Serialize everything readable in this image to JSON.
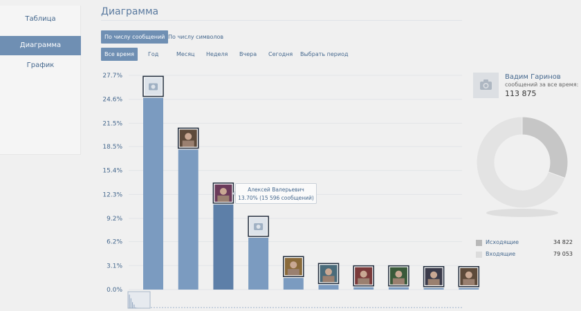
{
  "nav": {
    "items": [
      {
        "label": "Таблица"
      },
      {
        "label": "Диаграмма"
      },
      {
        "label": "График"
      }
    ]
  },
  "page_title": "Диаграмма",
  "metric_tabs": [
    {
      "label": "По числу сообщений"
    },
    {
      "label": "По числу символов"
    }
  ],
  "period_tabs": [
    {
      "label": "Все время"
    },
    {
      "label": "Год"
    },
    {
      "label": "Месяц"
    },
    {
      "label": "Неделя"
    },
    {
      "label": "Вчера"
    },
    {
      "label": "Сегодня"
    },
    {
      "label": "Выбрать период"
    }
  ],
  "tooltip": {
    "name": "Алексей Валерьевич",
    "value": "13.70% (15 596 сообщений)"
  },
  "user": {
    "name": "Вадим Гаринов",
    "subtitle": "сообщений за все время:",
    "count": "113 875"
  },
  "legend": [
    {
      "label": "Исходящие",
      "value": "34 822",
      "color": "#b8b8b8"
    },
    {
      "label": "Входящие",
      "value": "79 053",
      "color": "#dcdcdc"
    }
  ],
  "colors": {
    "accent": "#6f8fb3",
    "bar": "#7b9bc0",
    "bar_highlight": "#5d7fa8",
    "donut_out": "#c6c6c6",
    "donut_in": "#e3e3e3"
  },
  "chart_data": {
    "type": "bar",
    "ylabel": "",
    "ylim": [
      0,
      27.7
    ],
    "ticks": [
      "0.0%",
      "3.1%",
      "6.2%",
      "9.2%",
      "12.3%",
      "15.4%",
      "18.5%",
      "21.5%",
      "24.6%",
      "27.7%"
    ],
    "values": [
      24.8,
      18.1,
      11.0,
      6.7,
      1.5,
      0.6,
      0.3,
      0.3,
      0.2,
      0.2
    ],
    "highlight_index": 2,
    "avatars": [
      "camera-icon",
      "photo",
      "photo",
      "camera-icon",
      "photo",
      "photo",
      "photo",
      "photo",
      "photo",
      "photo"
    ]
  },
  "donut_data": {
    "type": "pie",
    "values": [
      34822,
      79053
    ]
  }
}
